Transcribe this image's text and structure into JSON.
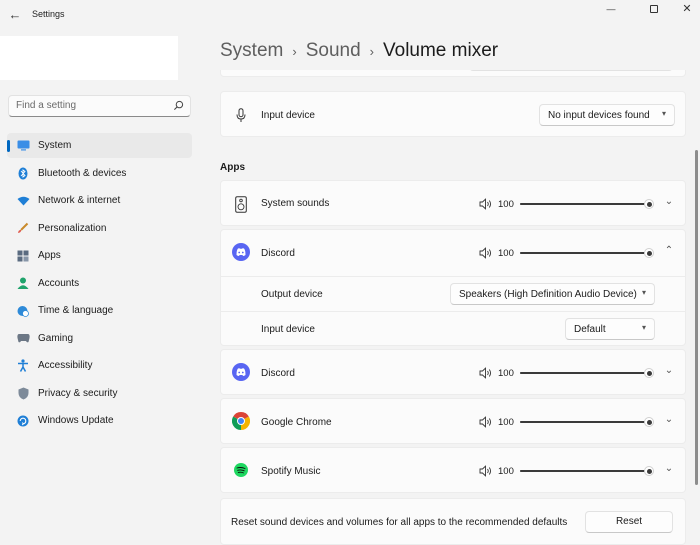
{
  "window": {
    "title": "Settings",
    "back_glyph": "←",
    "minimize_glyph": "—",
    "close_glyph": "✕"
  },
  "search": {
    "placeholder": "Find a setting"
  },
  "sidebar": {
    "items": [
      {
        "label": "System",
        "icon": "system-icon",
        "active": true
      },
      {
        "label": "Bluetooth & devices",
        "icon": "bluetooth-icon"
      },
      {
        "label": "Network & internet",
        "icon": "wifi-icon"
      },
      {
        "label": "Personalization",
        "icon": "brush-icon"
      },
      {
        "label": "Apps",
        "icon": "apps-icon"
      },
      {
        "label": "Accounts",
        "icon": "person-icon"
      },
      {
        "label": "Time & language",
        "icon": "globe-clock-icon"
      },
      {
        "label": "Gaming",
        "icon": "gamepad-icon"
      },
      {
        "label": "Accessibility",
        "icon": "accessibility-icon"
      },
      {
        "label": "Privacy & security",
        "icon": "shield-icon"
      },
      {
        "label": "Windows Update",
        "icon": "update-icon"
      }
    ]
  },
  "breadcrumb": {
    "items": [
      "System",
      "Sound"
    ],
    "current": "Volume mixer",
    "separator": "›"
  },
  "input_device": {
    "label": "Input device",
    "value": "No input devices found"
  },
  "apps_section": {
    "label": "Apps"
  },
  "apps": [
    {
      "name": "System sounds",
      "icon": "speaker-device-icon",
      "volume": 100,
      "expanded": false
    },
    {
      "name": "Discord",
      "icon": "discord-icon",
      "volume": 100,
      "expanded": true,
      "output_label": "Output device",
      "output_value": "Speakers (High Definition Audio Device)",
      "input_label": "Input device",
      "input_value": "Default"
    },
    {
      "name": "Discord",
      "icon": "discord-icon",
      "volume": 100,
      "expanded": false
    },
    {
      "name": "Google Chrome",
      "icon": "chrome-icon",
      "volume": 100,
      "expanded": false
    },
    {
      "name": "Spotify Music",
      "icon": "spotify-icon",
      "volume": 100,
      "expanded": false
    }
  ],
  "reset": {
    "text": "Reset sound devices and volumes for all apps to the recommended defaults",
    "button": "Reset"
  },
  "glyphs": {
    "chevron_down": "⌄",
    "chevron_up": "⌃",
    "select_chevron": "▾"
  },
  "colors": {
    "accent": "#0067c0",
    "discord": "#5865f2",
    "spotify": "#1ed760",
    "background": "#f3f3f3",
    "card": "#fbfbfb"
  }
}
